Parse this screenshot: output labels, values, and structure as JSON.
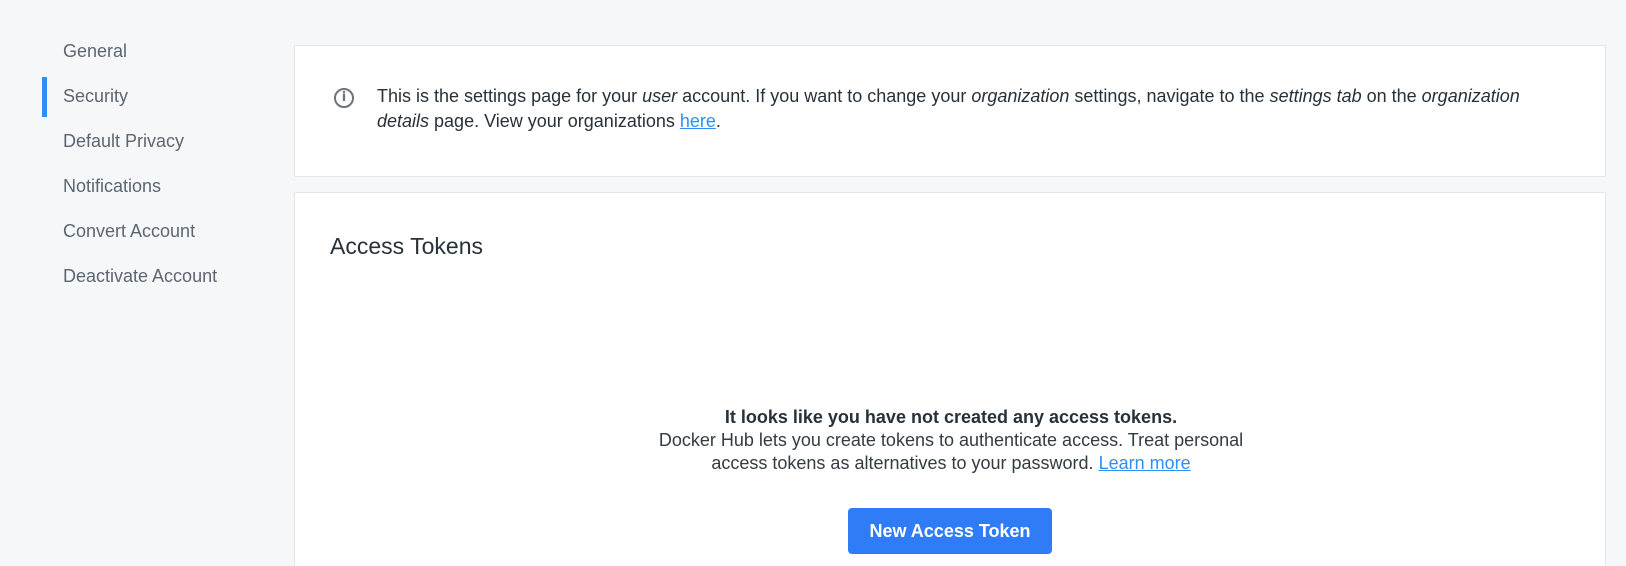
{
  "sidebar": {
    "items": [
      {
        "label": "General"
      },
      {
        "label": "Security",
        "active": true
      },
      {
        "label": "Default Privacy"
      },
      {
        "label": "Notifications"
      },
      {
        "label": "Convert Account"
      },
      {
        "label": "Deactivate Account"
      }
    ]
  },
  "info_notice": {
    "icon": "info-circle-icon",
    "text_1": "This is the settings page for your ",
    "em_user": "user",
    "text_2": " account. If you want to change your ",
    "em_organization": "organization",
    "text_3": " settings, navigate to the ",
    "em_settings_tab": "settings tab",
    "text_4": " on the ",
    "em_organization_details": "organization details",
    "text_5": " page. View your organizations ",
    "link_here": "here",
    "text_6": "."
  },
  "access_tokens": {
    "title": "Access Tokens",
    "empty_title": "It looks like you have not created any access tokens.",
    "empty_line_1": "Docker Hub lets you create tokens to authenticate access. Treat personal",
    "empty_line_2": "access tokens as alternatives to your password. ",
    "learn_more": "Learn more",
    "button_label": "New Access Token"
  },
  "colors": {
    "accent": "#2f8ff5",
    "button": "#2f7cf6",
    "background": "#f6f7f9",
    "card": "#ffffff"
  }
}
